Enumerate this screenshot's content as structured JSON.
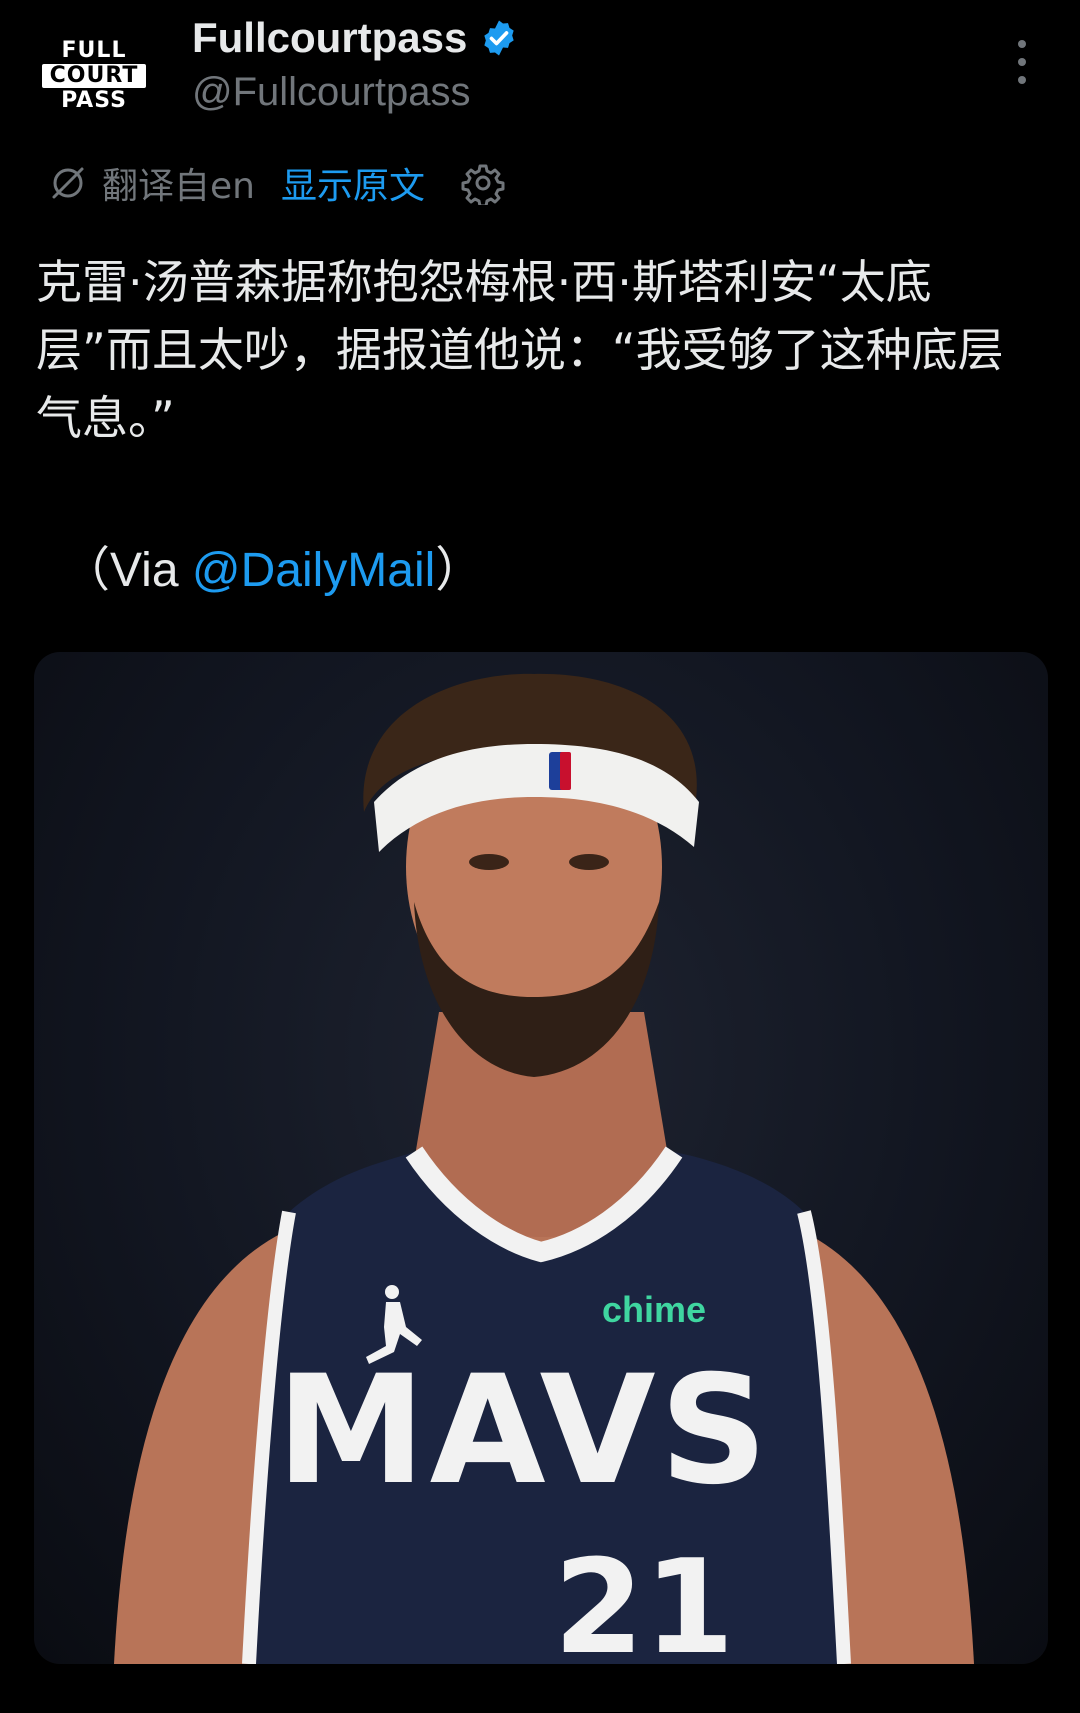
{
  "author": {
    "avatar_lines": [
      "FULL",
      "COURT",
      "PASS"
    ],
    "display_name": "Fullcourtpass",
    "handle": "@Fullcourtpass",
    "verified": true
  },
  "translation": {
    "label": "翻译自en",
    "show_original": "显示原文"
  },
  "tweet": {
    "text": "克雷·汤普森据称抱怨梅根·西·斯塔利安“太底层”而且太吵，据报道他说：“我受够了这种底层气息。”",
    "via_open": "（Via ",
    "via_mention": "@DailyMail",
    "via_close": "）"
  },
  "media": {
    "jersey_wordmark": "MAVS",
    "jersey_number": "21",
    "sponsor": "chime"
  },
  "colors": {
    "background": "#000000",
    "link": "#1d9bf0",
    "secondary_text": "#71767b",
    "primary_text": "#e7e9ea",
    "jersey": "#1b2440",
    "sponsor": "#3fd6a0"
  },
  "icons": [
    "verified-badge-icon",
    "more-options-icon",
    "translate-icon",
    "settings-gear-icon"
  ]
}
